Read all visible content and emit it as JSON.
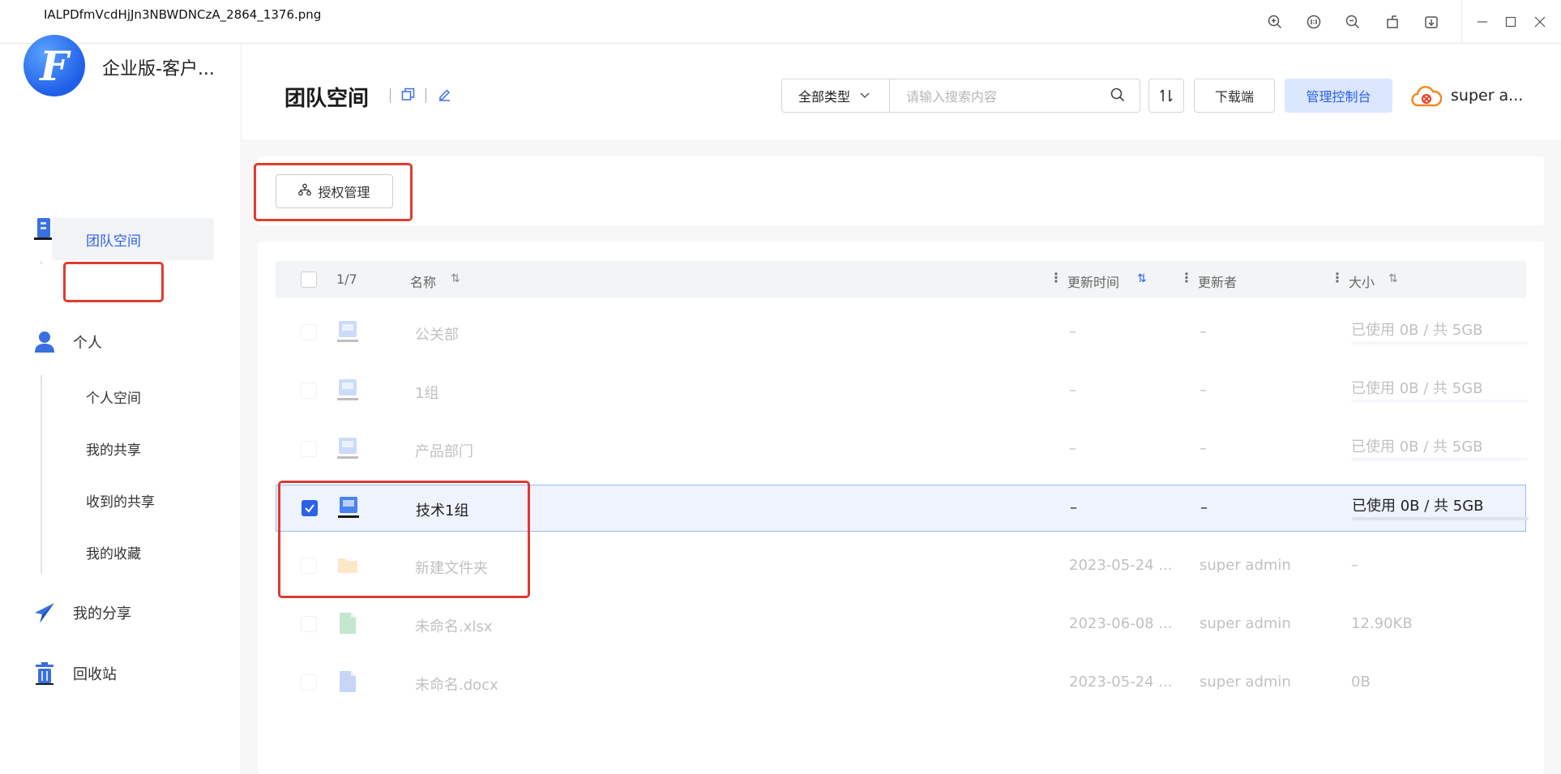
{
  "viewer": {
    "filename": "IALPDfmVcdHjJn3NBWDNCzA_2864_1376.png",
    "tools": [
      "zoom-in-icon",
      "actual-size-icon",
      "zoom-out-icon",
      "rotate-icon",
      "download-icon"
    ],
    "window": [
      "minimize-icon",
      "maximize-icon",
      "close-icon"
    ]
  },
  "sidebar": {
    "brand": "企业版-客户...",
    "enterprise": "企业",
    "team_space": "团队空间",
    "personal": "个人",
    "personal_items": [
      "个人空间",
      "我的共享",
      "收到的共享",
      "我的收藏"
    ],
    "my_share": "我的分享",
    "recycle": "回收站"
  },
  "header": {
    "title": "团队空间",
    "type_select": "全部类型",
    "search_placeholder": "请输入搜索内容",
    "download": "下载端",
    "console": "管理控制台",
    "user": "super a..."
  },
  "toolbar": {
    "auth_manage": "授权管理"
  },
  "table": {
    "count": "1/7",
    "columns": {
      "name": "名称",
      "updated": "更新时间",
      "updater": "更新者",
      "size": "大小"
    },
    "rows": [
      {
        "name": "公关部",
        "updated": "–",
        "updater": "–",
        "size": "已使用 0B / 共 5GB",
        "type": "team-drive",
        "faded": true,
        "selected": false
      },
      {
        "name": "1组",
        "updated": "–",
        "updater": "–",
        "size": "已使用 0B / 共 5GB",
        "type": "team-drive",
        "faded": true,
        "selected": false
      },
      {
        "name": "产品部门",
        "updated": "–",
        "updater": "–",
        "size": "已使用 0B / 共 5GB",
        "type": "team-drive",
        "faded": true,
        "selected": false
      },
      {
        "name": "技术1组",
        "updated": "–",
        "updater": "–",
        "size": "已使用 0B / 共 5GB",
        "type": "team-drive",
        "faded": false,
        "selected": true
      },
      {
        "name": "新建文件夹",
        "updated": "2023-05-24 ...",
        "updater": "super admin",
        "size": "–",
        "type": "folder",
        "faded": true,
        "selected": false
      },
      {
        "name": "未命名.xlsx",
        "updated": "2023-06-08 ...",
        "updater": "super admin",
        "size": "12.90KB",
        "type": "xlsx",
        "faded": true,
        "selected": false
      },
      {
        "name": "未命名.docx",
        "updated": "2023-05-24 ...",
        "updater": "super admin",
        "size": "0B",
        "type": "docx",
        "faded": true,
        "selected": false
      }
    ]
  },
  "colors": {
    "accent": "#2a62e8",
    "highlight": "#e03a30",
    "console_bg": "#dbe7ff"
  }
}
